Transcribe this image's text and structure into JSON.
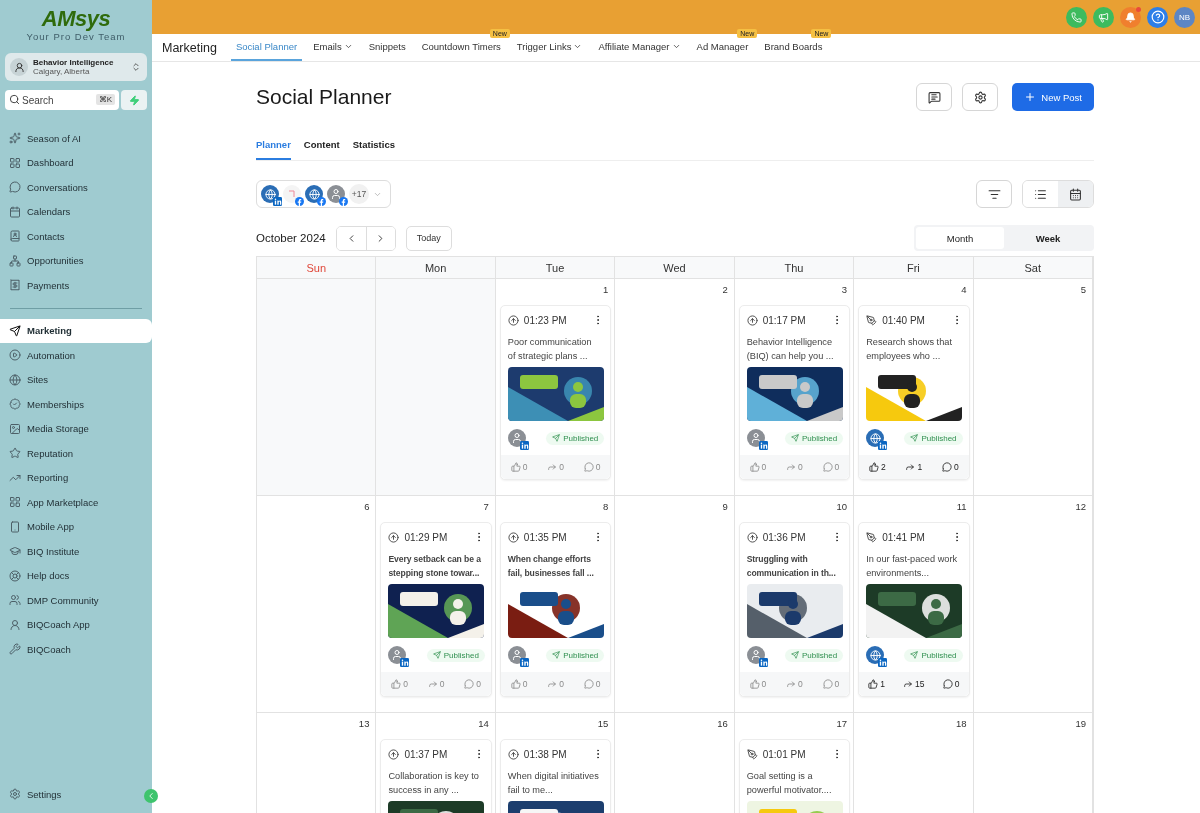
{
  "brand": {
    "wordmark": "**AM**sys",
    "tagline": "Your Pro Dev Team"
  },
  "account": {
    "name": "Behavior Intelligence",
    "location": "Calgary, Alberta"
  },
  "search": {
    "placeholder": "Search",
    "shortcut": "⌘K"
  },
  "nav_primary": [
    {
      "label": "Season of AI",
      "selected": false
    },
    {
      "label": "Dashboard",
      "selected": false
    },
    {
      "label": "Conversations",
      "selected": false
    },
    {
      "label": "Calendars",
      "selected": false
    },
    {
      "label": "Contacts",
      "selected": false
    },
    {
      "label": "Opportunities",
      "selected": false
    },
    {
      "label": "Payments",
      "selected": false
    }
  ],
  "nav_secondary": [
    {
      "label": "Marketing",
      "selected": true
    },
    {
      "label": "Automation",
      "selected": false
    },
    {
      "label": "Sites",
      "selected": false
    },
    {
      "label": "Memberships",
      "selected": false
    },
    {
      "label": "Media Storage",
      "selected": false
    },
    {
      "label": "Reputation",
      "selected": false
    },
    {
      "label": "Reporting",
      "selected": false
    },
    {
      "label": "App Marketplace",
      "selected": false
    },
    {
      "label": "Mobile App",
      "selected": false
    },
    {
      "label": "BIQ Institute",
      "selected": false
    },
    {
      "label": "Help docs",
      "selected": false
    },
    {
      "label": "DMP Community",
      "selected": false
    },
    {
      "label": "BIQCoach App",
      "selected": false
    },
    {
      "label": "BIQCoach",
      "selected": false
    }
  ],
  "settings_label": "Settings",
  "user_initials": "NB",
  "notifications": {
    "unread": true
  },
  "section_title": "Marketing",
  "top_tabs": [
    {
      "label": "Social Planner",
      "selected": true,
      "dropdown": false
    },
    {
      "label": "Emails",
      "selected": false,
      "dropdown": true
    },
    {
      "label": "Snippets",
      "selected": false,
      "dropdown": false
    },
    {
      "label": "Countdown Timers",
      "selected": false,
      "dropdown": false,
      "badge": "New"
    },
    {
      "label": "Trigger Links",
      "selected": false,
      "dropdown": true
    },
    {
      "label": "Affiliate Manager",
      "selected": false,
      "dropdown": true
    },
    {
      "label": "Ad Manager",
      "selected": false,
      "dropdown": false,
      "badge": "New"
    },
    {
      "label": "Brand Boards",
      "selected": false,
      "dropdown": false,
      "badge": "New"
    }
  ],
  "page_title": "Social Planner",
  "new_post_label": "New Post",
  "sub_tabs": [
    {
      "label": "Planner",
      "selected": true
    },
    {
      "label": "Content",
      "selected": false
    },
    {
      "label": "Statistics",
      "selected": false
    }
  ],
  "accounts": {
    "more": "+17",
    "items": [
      {
        "kind": "linkedin",
        "avatar": {
          "kind": "logo"
        }
      },
      {
        "kind": "facebook",
        "avatar": {
          "kind": "blank"
        }
      },
      {
        "kind": "facebook",
        "avatar": {
          "kind": "logo"
        }
      },
      {
        "kind": "facebook",
        "avatar": {
          "kind": "person"
        }
      }
    ]
  },
  "views": [
    {
      "kind": "list",
      "selected": false
    },
    {
      "kind": "calendar",
      "selected": true
    }
  ],
  "month_label": "October 2024",
  "today_label": "Today",
  "ranges": [
    {
      "label": "Month",
      "selected": true
    },
    {
      "label": "Week",
      "selected": false
    }
  ],
  "weekdays": [
    {
      "label": "Sun",
      "highlighted": true
    },
    {
      "label": "Mon",
      "highlighted": false
    },
    {
      "label": "Tue",
      "highlighted": false
    },
    {
      "label": "Wed",
      "highlighted": false
    },
    {
      "label": "Thu",
      "highlighted": false
    },
    {
      "label": "Fri",
      "highlighted": false
    },
    {
      "label": "Sat",
      "highlighted": false
    }
  ],
  "weeks": [
    [
      {
        "kind": "blank"
      },
      {
        "kind": "blank"
      },
      {
        "kind": "day",
        "date": "1",
        "post": {
          "kind": "upload",
          "time": "01:23 PM",
          "text": "Poor communication of strategic plans ...",
          "bold": false,
          "avatar": {
            "kind": "person"
          },
          "status": "Published",
          "likes": "0",
          "shares": "0",
          "comments": "0",
          "engaged": false
        }
      },
      {
        "kind": "day",
        "date": "2"
      },
      {
        "kind": "day",
        "date": "3",
        "post": {
          "kind": "upload",
          "time": "01:17 PM",
          "text": "Behavior Intelligence (BIQ) can help you ...",
          "bold": false,
          "avatar": {
            "kind": "person"
          },
          "status": "Published",
          "likes": "0",
          "shares": "0",
          "comments": "0",
          "engaged": false
        }
      },
      {
        "kind": "day",
        "date": "4",
        "post": {
          "kind": "pen",
          "time": "01:40 PM",
          "text": "Research shows that employees who ...",
          "bold": false,
          "avatar": {
            "kind": "logo"
          },
          "status": "Published",
          "likes": "2",
          "shares": "1",
          "comments": "0",
          "engaged": true
        }
      },
      {
        "kind": "day",
        "date": "5"
      }
    ],
    [
      {
        "kind": "day",
        "date": "6"
      },
      {
        "kind": "day",
        "date": "7",
        "post": {
          "kind": "upload",
          "time": "01:29 PM",
          "text": "Every setback can be a stepping stone towar...",
          "bold": true,
          "avatar": {
            "kind": "person"
          },
          "status": "Published",
          "likes": "0",
          "shares": "0",
          "comments": "0",
          "engaged": false
        }
      },
      {
        "kind": "day",
        "date": "8",
        "post": {
          "kind": "upload",
          "time": "01:35 PM",
          "text": "When change efforts fail, businesses fall ...",
          "bold": true,
          "avatar": {
            "kind": "person"
          },
          "status": "Published",
          "likes": "0",
          "shares": "0",
          "comments": "0",
          "engaged": false
        }
      },
      {
        "kind": "day",
        "date": "9"
      },
      {
        "kind": "day",
        "date": "10",
        "post": {
          "kind": "upload",
          "time": "01:36 PM",
          "text": "Struggling with communication in th...",
          "bold": true,
          "avatar": {
            "kind": "person"
          },
          "status": "Published",
          "likes": "0",
          "shares": "0",
          "comments": "0",
          "engaged": false
        }
      },
      {
        "kind": "day",
        "date": "11",
        "post": {
          "kind": "pen",
          "time": "01:41 PM",
          "text": "In our fast-paced work environments...",
          "bold": false,
          "avatar": {
            "kind": "logo"
          },
          "status": "Published",
          "likes": "1",
          "shares": "15",
          "comments": "0",
          "engaged": true
        }
      },
      {
        "kind": "day",
        "date": "12"
      }
    ],
    [
      {
        "kind": "day",
        "date": "13"
      },
      {
        "kind": "day",
        "date": "14",
        "post": {
          "kind": "upload",
          "time": "01:37 PM",
          "text": "Collaboration is key to success in any ...",
          "bold": false
        }
      },
      {
        "kind": "day",
        "date": "15",
        "post": {
          "kind": "upload",
          "time": "01:38 PM",
          "text": "When digital initiatives fail to me...",
          "bold": false
        }
      },
      {
        "kind": "day",
        "date": "16"
      },
      {
        "kind": "day",
        "date": "17",
        "post": {
          "kind": "pen",
          "time": "01:01 PM",
          "text": "Goal setting is a powerful motivator....",
          "bold": false
        }
      },
      {
        "kind": "day",
        "date": "18"
      },
      {
        "kind": "day",
        "date": "19"
      }
    ]
  ]
}
